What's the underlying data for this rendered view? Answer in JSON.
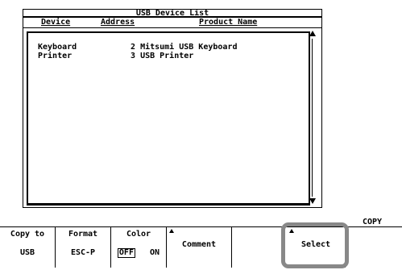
{
  "window": {
    "title": "USB Device List"
  },
  "columns": [
    "Device",
    "Address",
    "Product Name"
  ],
  "devices": [
    {
      "device": "Keyboard",
      "address": "2",
      "product": "Mitsumi USB Keyboard"
    },
    {
      "device": "Printer",
      "address": "3",
      "product": "USB Printer"
    }
  ],
  "softkeys": {
    "group_label": "COPY",
    "copy_to": {
      "label": "Copy to",
      "value": "USB"
    },
    "format": {
      "label": "Format",
      "value": "ESC-P"
    },
    "color": {
      "label": "Color",
      "off": "OFF",
      "on": "ON",
      "selected": "OFF"
    },
    "comment": {
      "label": "Comment"
    },
    "select": {
      "label": "Select"
    }
  },
  "colors": {
    "highlight": "#888888",
    "foreground": "#000000",
    "background": "#ffffff"
  }
}
